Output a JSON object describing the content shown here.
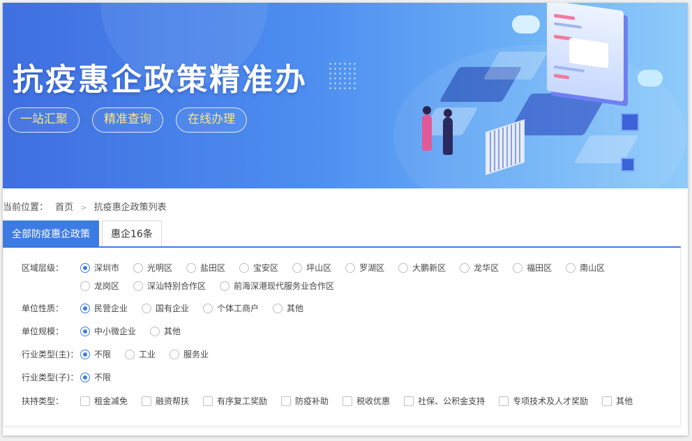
{
  "banner": {
    "title": "抗疫惠企政策精准办",
    "pills": [
      "一站汇聚",
      "精准查询",
      "在线办理"
    ]
  },
  "breadcrumb": {
    "prefix": "当前位置：",
    "items": [
      "首页",
      "抗疫惠企政策列表"
    ],
    "separator": ">"
  },
  "tabs": [
    {
      "label": "全部防疫惠企政策",
      "active": true
    },
    {
      "label": "惠企16条",
      "active": false
    }
  ],
  "filters": {
    "region": {
      "label": "区域层级：",
      "options": [
        "深圳市",
        "光明区",
        "盐田区",
        "宝安区",
        "坪山区",
        "罗湖区",
        "大鹏新区",
        "龙华区",
        "福田区",
        "南山区",
        "龙岗区",
        "深汕特别合作区",
        "前海深港现代服务业合作区"
      ],
      "selected": "深圳市"
    },
    "unit_nature": {
      "label": "单位性质：",
      "options": [
        "民营企业",
        "国有企业",
        "个体工商户",
        "其他"
      ],
      "selected": "民营企业"
    },
    "unit_scale": {
      "label": "单位规模：",
      "options": [
        "中小微企业",
        "其他"
      ],
      "selected": "中小微企业"
    },
    "industry_main": {
      "label": "行业类型(主)：",
      "options": [
        "不限",
        "工业",
        "服务业"
      ],
      "selected": "不限"
    },
    "industry_sub": {
      "label": "行业类型(子)：",
      "options": [
        "不限"
      ],
      "selected": "不限"
    },
    "support_type": {
      "label": "扶持类型：",
      "options": [
        "租金减免",
        "融资帮扶",
        "有序复工奖励",
        "防疫补助",
        "税收优惠",
        "社保、公积金支持",
        "专项技术及人才奖励",
        "其他"
      ],
      "checked": []
    }
  },
  "colors": {
    "accent": "#3d7be4",
    "pill_text": "#ffe680",
    "banner_start": "#3f6fe0",
    "banner_end": "#8fcbfa"
  }
}
